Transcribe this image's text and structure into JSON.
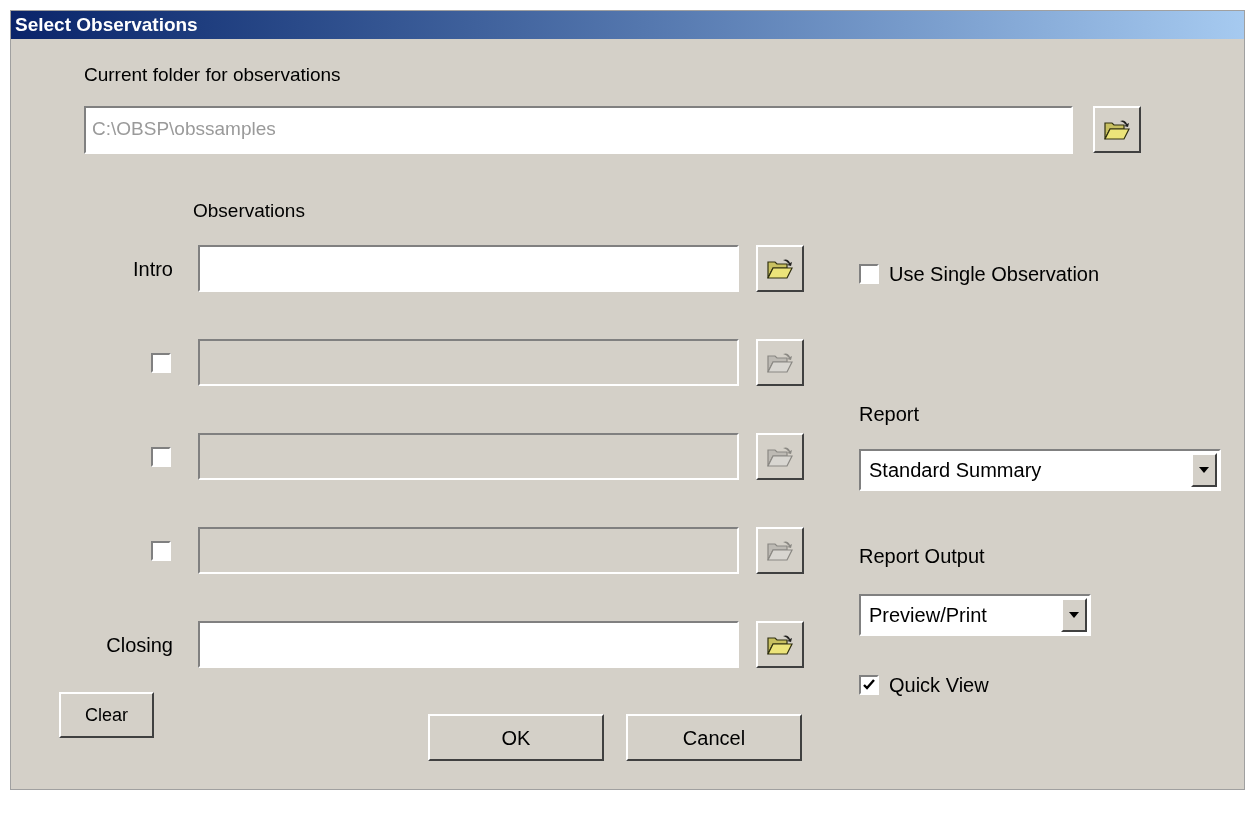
{
  "window": {
    "title": "Select Observations"
  },
  "folder": {
    "label": "Current folder for observations",
    "value": "C:\\OBSP\\obssamples",
    "disabled": true
  },
  "observations": {
    "heading": "Observations",
    "rows": [
      {
        "kind": "labeled",
        "label": "Intro",
        "disabled": false
      },
      {
        "kind": "checkbox",
        "checked": false,
        "disabled": true
      },
      {
        "kind": "checkbox",
        "checked": false,
        "disabled": true
      },
      {
        "kind": "checkbox",
        "checked": false,
        "disabled": true
      },
      {
        "kind": "labeled",
        "label": "Closing",
        "disabled": false
      }
    ]
  },
  "use_single": {
    "label": "Use Single Observation",
    "checked": false
  },
  "report": {
    "label": "Report",
    "value": "Standard Summary"
  },
  "report_output": {
    "label": "Report Output",
    "value": "Preview/Print"
  },
  "quick_view": {
    "label": "Quick View",
    "checked": true
  },
  "clear_button": "Clear",
  "buttons": [
    "OK",
    "Cancel"
  ]
}
